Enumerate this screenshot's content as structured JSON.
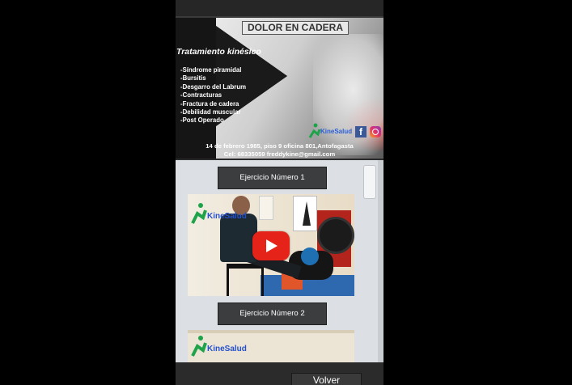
{
  "banner": {
    "title": "DOLOR EN CADERA",
    "subtitle": "Tratamiento kinésico",
    "conditions": [
      "-Síndrome piramidal",
      "-Bursitis",
      "-Desgarro del Labrum",
      "-Contracturas",
      "-Fractura de cadera",
      "-Debilidad muscular",
      "-Post Operado"
    ],
    "brand": "KineSalud",
    "address_line1": "14 de febrero 1985, piso 9 oficina 801,Antofagasta",
    "address_line2": "Cel: 68335059 freddykine@gmail.com",
    "social_icons": [
      "facebook-icon",
      "instagram-icon"
    ]
  },
  "exercises": [
    {
      "title": "Ejercicio Número 1",
      "brand": "KineSalud",
      "icon": "play-icon"
    },
    {
      "title": "Ejercicio Número 2",
      "brand": "KineSalud"
    }
  ],
  "footer": {
    "back_label": "Volver"
  },
  "colors": {
    "background": "#000000",
    "panel": "#dcdfe3",
    "button": "#3b3d3f",
    "play": "#e52318",
    "brand_blue": "#2350cf"
  }
}
